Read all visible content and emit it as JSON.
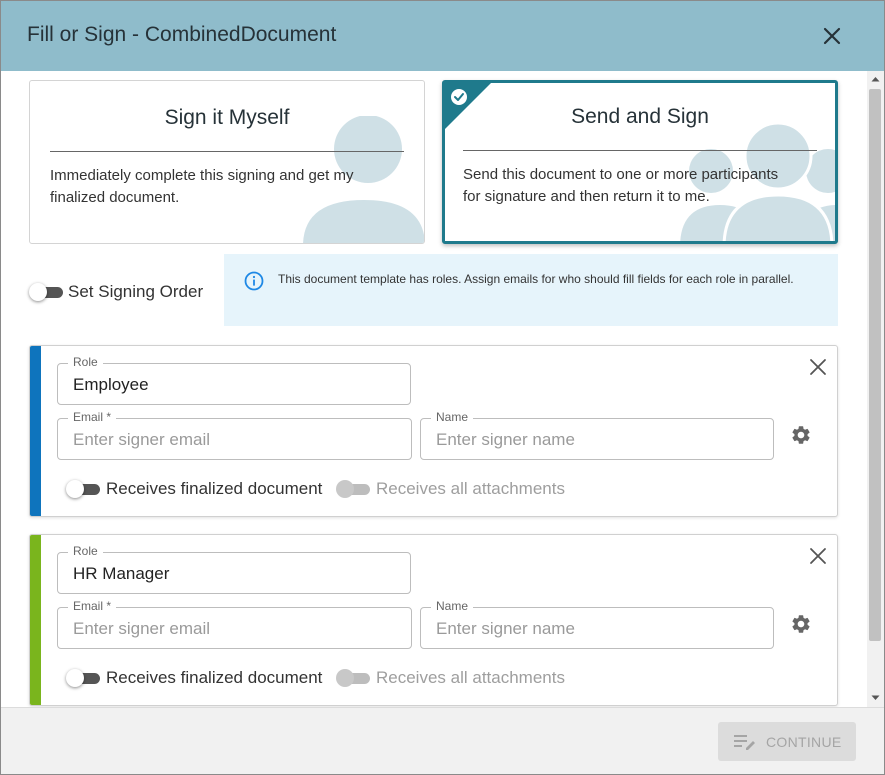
{
  "dialog": {
    "title": "Fill or Sign - CombinedDocument"
  },
  "options": [
    {
      "title": "Sign it Myself",
      "description": "Immediately complete this signing and get my finalized document.",
      "selected": false
    },
    {
      "title": "Send and Sign",
      "description": "Send this document to one or more participants for signature and then return it to me.",
      "selected": true
    }
  ],
  "signing_order": {
    "label": "Set Signing Order",
    "enabled": false
  },
  "info": {
    "text": "This document template has roles. Assign emails for who should fill fields for each role in parallel."
  },
  "roles": [
    {
      "accent_color": "#0e74bd",
      "role_label": "Role",
      "role_value": "Employee",
      "email_label": "Email *",
      "email_placeholder": "Enter signer email",
      "name_label": "Name",
      "name_placeholder": "Enter signer name",
      "receives_finalized_label": "Receives finalized document",
      "receives_attachments_label": "Receives all attachments"
    },
    {
      "accent_color": "#7ab51d",
      "role_label": "Role",
      "role_value": "HR Manager",
      "email_label": "Email *",
      "email_placeholder": "Enter signer email",
      "name_label": "Name",
      "name_placeholder": "Enter signer name",
      "receives_finalized_label": "Receives finalized document",
      "receives_attachments_label": "Receives all attachments"
    }
  ],
  "footer": {
    "continue_label": "CONTINUE",
    "continue_enabled": false
  },
  "colors": {
    "header": "#8fbccb",
    "selected_border": "#1f7a8c",
    "info_background": "#e6f4fb",
    "art": "#cfe0e6"
  },
  "icons": {
    "close": "close-icon",
    "check": "check-badge-icon",
    "info": "info-icon",
    "gear": "gear-icon",
    "continue": "edit-lines-icon"
  }
}
